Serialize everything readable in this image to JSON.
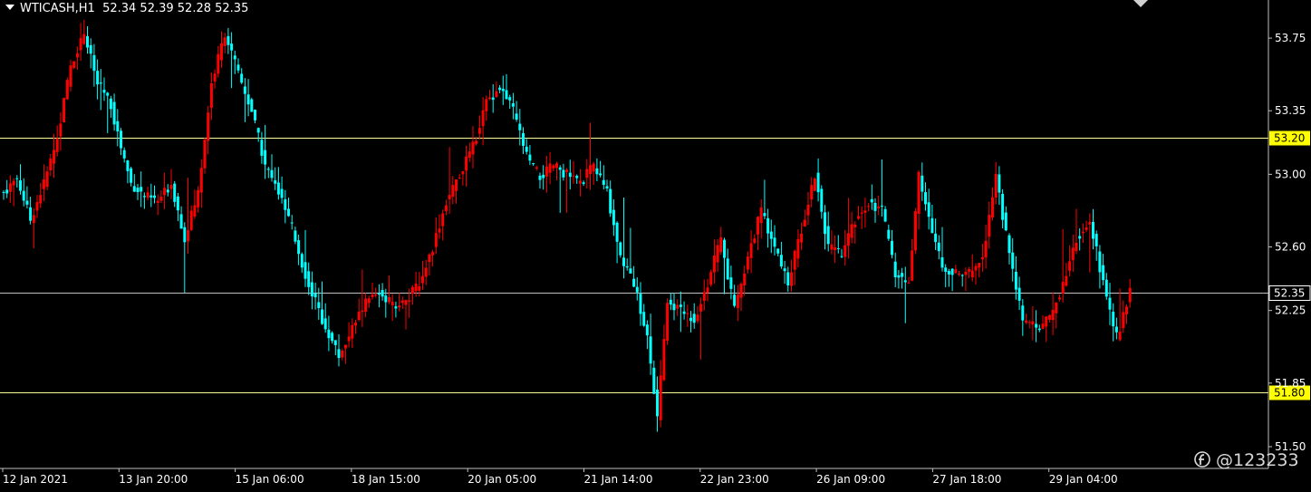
{
  "header": {
    "symbol": "WTICASH,H1",
    "ohlc": "52.34 52.39 52.28 52.35"
  },
  "watermark": "@123233",
  "colors": {
    "background": "#000000",
    "bull": "#ff0000",
    "bear": "#00ffff",
    "level_line": "#ffff99",
    "last_line": "#c0c0c0",
    "axis_text": "#ffffff"
  },
  "chart_data": {
    "type": "candlestick",
    "title": "WTICASH,H1",
    "ylim": [
      51.38,
      53.96
    ],
    "y_ticks": [
      "53.75",
      "53.35",
      "53.00",
      "52.60",
      "52.25",
      "51.85",
      "51.50"
    ],
    "x_ticks": [
      "12 Jan 2021",
      "13 Jan 20:00",
      "15 Jan 06:00",
      "18 Jan 15:00",
      "20 Jan 05:00",
      "21 Jan 14:00",
      "22 Jan 23:00",
      "26 Jan 09:00",
      "27 Jan 18:00",
      "29 Jan 04:00"
    ],
    "levels": [
      {
        "value": 53.2,
        "label": "53.20",
        "style": "yellow"
      },
      {
        "value": 52.35,
        "label": "52.35",
        "style": "last"
      },
      {
        "value": 51.8,
        "label": "51.80",
        "style": "yellow"
      }
    ],
    "close_path_anchors": [
      [
        0,
        52.9
      ],
      [
        4,
        52.98
      ],
      [
        8,
        52.75
      ],
      [
        12,
        52.95
      ],
      [
        16,
        53.2
      ],
      [
        20,
        53.6
      ],
      [
        24,
        53.78
      ],
      [
        28,
        53.5
      ],
      [
        32,
        53.38
      ],
      [
        35,
        53.15
      ],
      [
        38,
        52.95
      ],
      [
        42,
        52.88
      ],
      [
        46,
        52.85
      ],
      [
        50,
        52.95
      ],
      [
        54,
        52.65
      ],
      [
        58,
        52.9
      ],
      [
        62,
        53.5
      ],
      [
        66,
        53.78
      ],
      [
        70,
        53.55
      ],
      [
        74,
        53.35
      ],
      [
        78,
        53.05
      ],
      [
        82,
        52.9
      ],
      [
        86,
        52.7
      ],
      [
        90,
        52.45
      ],
      [
        95,
        52.2
      ],
      [
        100,
        52.0
      ],
      [
        104,
        52.15
      ],
      [
        108,
        52.3
      ],
      [
        112,
        52.35
      ],
      [
        116,
        52.28
      ],
      [
        120,
        52.3
      ],
      [
        124,
        52.4
      ],
      [
        128,
        52.6
      ],
      [
        132,
        52.85
      ],
      [
        136,
        53.0
      ],
      [
        140,
        53.15
      ],
      [
        144,
        53.4
      ],
      [
        148,
        53.48
      ],
      [
        152,
        53.35
      ],
      [
        156,
        53.1
      ],
      [
        160,
        52.98
      ],
      [
        164,
        53.05
      ],
      [
        168,
        53.0
      ],
      [
        172,
        52.95
      ],
      [
        176,
        53.05
      ],
      [
        180,
        52.9
      ],
      [
        184,
        52.55
      ],
      [
        188,
        52.4
      ],
      [
        192,
        52.1
      ],
      [
        195,
        51.65
      ],
      [
        198,
        52.3
      ],
      [
        202,
        52.25
      ],
      [
        206,
        52.2
      ],
      [
        210,
        52.4
      ],
      [
        214,
        52.65
      ],
      [
        218,
        52.25
      ],
      [
        222,
        52.55
      ],
      [
        226,
        52.8
      ],
      [
        230,
        52.6
      ],
      [
        234,
        52.4
      ],
      [
        238,
        52.7
      ],
      [
        242,
        53.0
      ],
      [
        246,
        52.6
      ],
      [
        250,
        52.55
      ],
      [
        254,
        52.75
      ],
      [
        258,
        52.85
      ],
      [
        262,
        52.8
      ],
      [
        266,
        52.45
      ],
      [
        270,
        52.4
      ],
      [
        273,
        53.0
      ],
      [
        276,
        52.75
      ],
      [
        280,
        52.5
      ],
      [
        284,
        52.45
      ],
      [
        288,
        52.45
      ],
      [
        292,
        52.55
      ],
      [
        296,
        53.0
      ],
      [
        300,
        52.55
      ],
      [
        304,
        52.2
      ],
      [
        308,
        52.15
      ],
      [
        312,
        52.2
      ],
      [
        316,
        52.4
      ],
      [
        320,
        52.65
      ],
      [
        324,
        52.75
      ],
      [
        328,
        52.4
      ],
      [
        332,
        52.1
      ],
      [
        336,
        52.35
      ]
    ],
    "candle_count": 337
  }
}
